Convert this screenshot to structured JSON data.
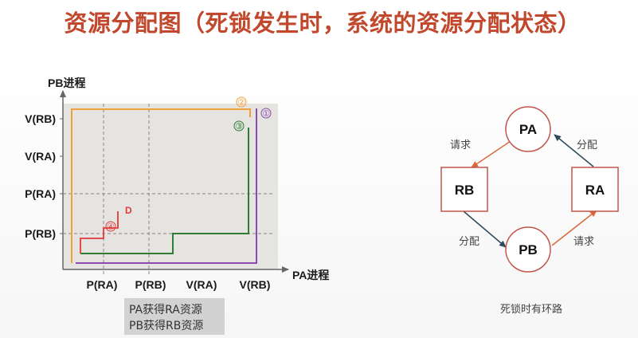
{
  "title": "资源分配图（死锁发生时，系统的资源分配状态）",
  "chart": {
    "y_axis_label": "PB进程",
    "x_axis_label": "PA进程",
    "y_ticks": [
      "V(RB)",
      "V(RA)",
      "P(RA)",
      "P(RB)"
    ],
    "x_ticks": [
      "P(RA)",
      "P(RB)",
      "V(RA)",
      "V(RB)"
    ],
    "path_markers": [
      "①",
      "②",
      "③",
      "④"
    ],
    "deadlock_label": "D",
    "note_lines": [
      "PA获得RA资源",
      "PB获得RB资源"
    ],
    "colors": {
      "path1": "#8a4cb0",
      "path2": "#f2a03c",
      "path3": "#2e7d32",
      "path4": "#e23a3a",
      "plot_bg": "#e6e4e1"
    }
  },
  "graph": {
    "process_a": "PA",
    "process_b": "PB",
    "resource_a": "RA",
    "resource_b": "RB",
    "edge_labels": {
      "pa_requests_rb": "请求",
      "ra_allocated_pa": "分配",
      "rb_allocated_pb": "分配",
      "pb_requests_ra": "请求"
    },
    "caption": "死锁时有环路",
    "colors": {
      "request_arrow": "#d9693d",
      "allocate_arrow": "#2e4a5a"
    }
  }
}
